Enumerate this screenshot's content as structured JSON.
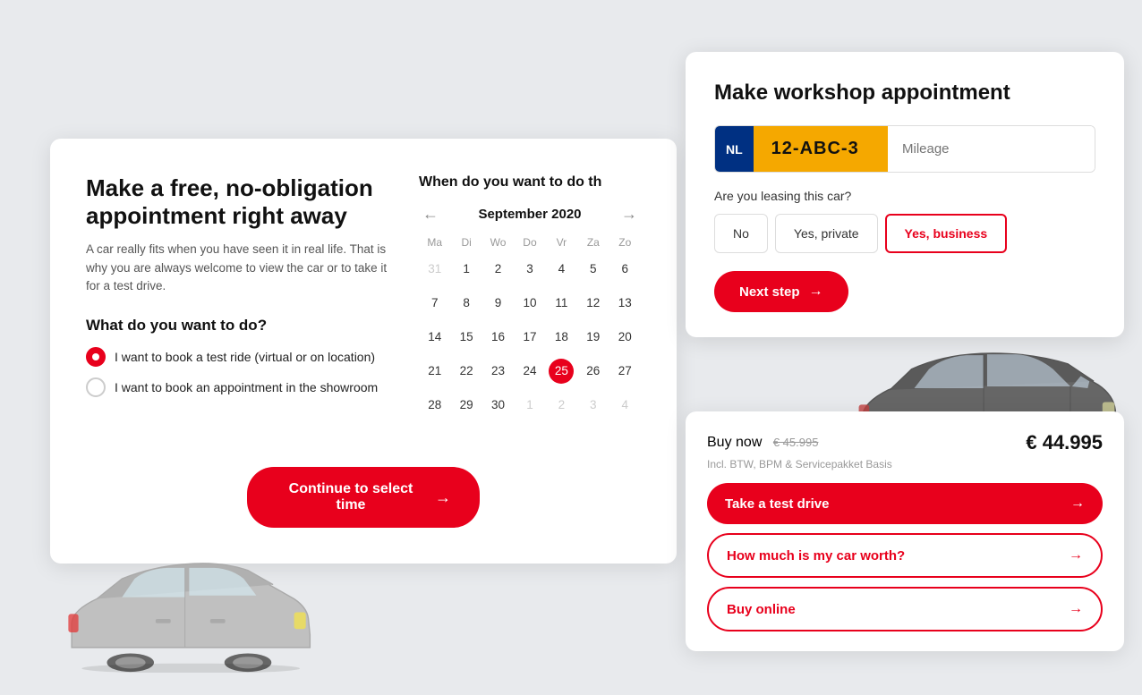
{
  "leftCard": {
    "title": "Make a free, no-obligation appointment right away",
    "subtitle": "A car really fits when you have seen it in real life. That is why you are always welcome to view the car or to take it for a test drive.",
    "whatToDo": "What do you want to do?",
    "options": [
      {
        "label": "I want to book a test ride (virtual or on location)",
        "checked": true
      },
      {
        "label": "I want to book an appointment in the showroom",
        "checked": false
      }
    ]
  },
  "calendar": {
    "title": "When do you want to do th",
    "month": "September 2020",
    "days": [
      "Ma",
      "Di",
      "Wo",
      "Do",
      "Vr",
      "Za",
      "Zo"
    ],
    "weeks": [
      [
        "31",
        "1",
        "2",
        "3",
        "4",
        "5",
        "6"
      ],
      [
        "7",
        "8",
        "9",
        "10",
        "11",
        "12",
        "13"
      ],
      [
        "14",
        "15",
        "16",
        "17",
        "18",
        "19",
        "20"
      ],
      [
        "21",
        "22",
        "23",
        "24",
        "25",
        "26",
        "27"
      ],
      [
        "28",
        "29",
        "30",
        "1",
        "2",
        "3",
        "4"
      ]
    ],
    "selectedDay": "25",
    "otherMonthDays": [
      "31",
      "1",
      "2",
      "3",
      "4"
    ],
    "continueBtn": "Continue to select time"
  },
  "rightCard": {
    "title": "Make workshop appointment",
    "licenseNL": "NL",
    "licensePlate": "12-ABC-3",
    "mileagePlaceholder": "Mileage",
    "leasingLabel": "Are you leasing this car?",
    "leasingOptions": [
      "No",
      "Yes, private",
      "Yes, business"
    ],
    "selectedLeasing": "Yes, business",
    "nextStepBtn": "Next step"
  },
  "priceCard": {
    "buyNow": "Buy now",
    "priceOriginal": "€ 45.995",
    "priceCurrent": "€ 44.995",
    "priceSubLabel": "Incl. BTW, BPM & Servicepakket Basis",
    "actions": [
      {
        "label": "Take a test drive",
        "style": "filled"
      },
      {
        "label": "How much is my car worth?",
        "style": "outline"
      },
      {
        "label": "Buy online",
        "style": "outline"
      }
    ]
  },
  "colors": {
    "primary": "#e8001c",
    "licenseBg": "#f5a800",
    "licenseNLBg": "#003082"
  }
}
